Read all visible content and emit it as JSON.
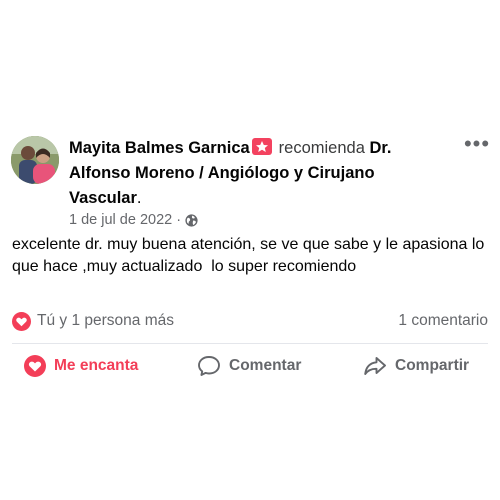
{
  "post": {
    "author": "Mayita Balmes Garnica",
    "verb": "recomienda",
    "target": "Dr. Alfonso Moreno / Angiólogo y Cirujano Vascular",
    "target_end": ".",
    "date": "1 de jul de 2022",
    "date_separator": "·",
    "audience_icon": "globe-icon",
    "body": "excelente dr. muy buena atención, se ve que sabe y le apasiona lo que hace ,muy actualizado  lo super recomiendo",
    "more_glyph": "•••"
  },
  "stats": {
    "reaction_icon": "heart-reaction-icon",
    "reactions_text": "Tú y 1 persona más",
    "comments_text": "1 comentario"
  },
  "actions": {
    "love_label": "Me encanta",
    "comment_label": "Comentar",
    "share_label": "Compartir"
  },
  "colors": {
    "love": "#f33e58",
    "secondary_text": "#65676b",
    "divider": "#e4e6eb",
    "badge": "#f3425f"
  }
}
